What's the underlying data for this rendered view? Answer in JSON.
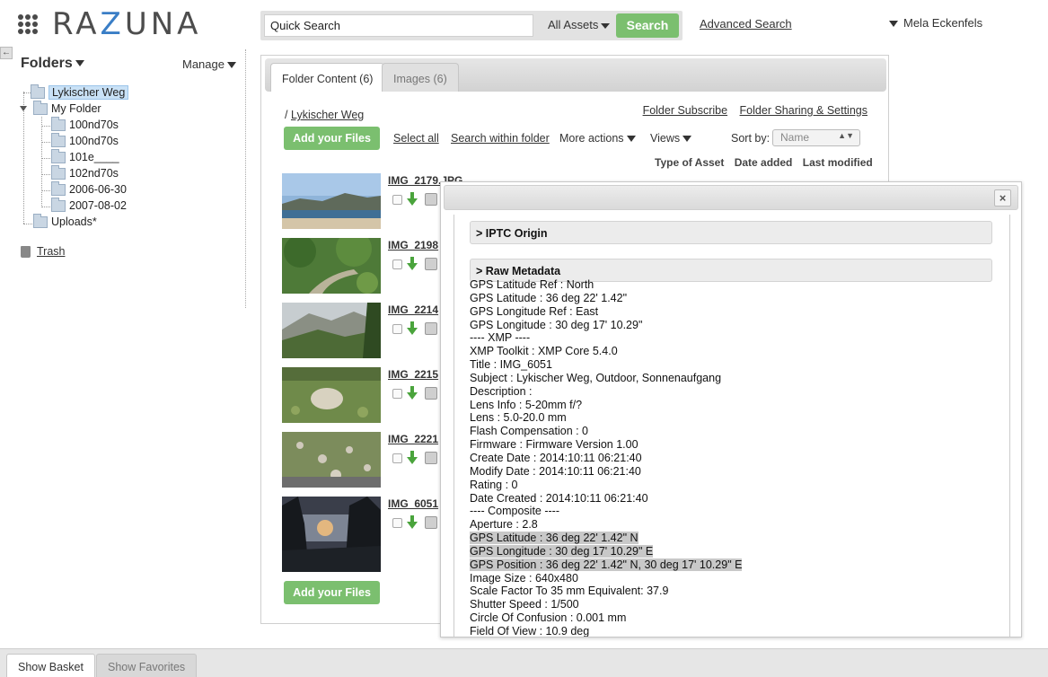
{
  "header": {
    "logo_text_1": "R",
    "logo_text_2": "A",
    "logo_text_z": "Z",
    "logo_text_3": "UNA",
    "search_value": "Quick Search",
    "asset_scope": "All Assets",
    "search_button": "Search",
    "advanced_search": "Advanced Search",
    "user_name": "Mela Eckenfels"
  },
  "sidebar": {
    "collapse_glyph": "←",
    "title": "Folders",
    "manage": "Manage",
    "tree": [
      {
        "label": "Lykischer Weg"
      },
      {
        "label": "My Folder"
      },
      {
        "label": "100nd70s"
      },
      {
        "label": "100nd70s"
      },
      {
        "label": "101e____"
      },
      {
        "label": "102nd70s"
      },
      {
        "label": "2006-06-30"
      },
      {
        "label": "2007-08-02"
      },
      {
        "label": "Uploads*"
      }
    ],
    "trash": "Trash"
  },
  "main": {
    "tabs": [
      {
        "label": "Folder Content (6)"
      },
      {
        "label": "Images (6)"
      }
    ],
    "breadcrumb_sep": "/",
    "breadcrumb": "Lykischer Weg",
    "folder_subscribe": "Folder Subscribe",
    "folder_sharing": "Folder Sharing & Settings",
    "add_files": "Add your Files",
    "select_all": "Select all",
    "search_within": "Search within folder",
    "more_actions": "More actions",
    "views": "Views",
    "sort_label": "Sort by:",
    "sort_value": "Name",
    "columns": [
      "Type of Asset",
      "Date added",
      "Last modified"
    ],
    "assets": [
      {
        "name": "IMG_2179.JPG"
      },
      {
        "name": "IMG_2198"
      },
      {
        "name": "IMG_2214"
      },
      {
        "name": "IMG_2215"
      },
      {
        "name": "IMG_2221"
      },
      {
        "name": "IMG_6051"
      }
    ]
  },
  "dialog": {
    "close": "×",
    "sections": [
      {
        "label": "> IPTC Origin"
      },
      {
        "label": "> Raw Metadata"
      }
    ],
    "lines": [
      {
        "text": "GPS Latitude Ref : North",
        "hl": false
      },
      {
        "text": "GPS Latitude : 36 deg 22' 1.42\"",
        "hl": false
      },
      {
        "text": "GPS Longitude Ref : East",
        "hl": false
      },
      {
        "text": "GPS Longitude : 30 deg 17' 10.29\"",
        "hl": false
      },
      {
        "text": "---- XMP ----",
        "hl": false
      },
      {
        "text": "XMP Toolkit : XMP Core 5.4.0",
        "hl": false
      },
      {
        "text": "Title : IMG_6051",
        "hl": false
      },
      {
        "text": "Subject : Lykischer Weg, Outdoor, Sonnenaufgang",
        "hl": false
      },
      {
        "text": "Description :",
        "hl": false
      },
      {
        "text": "Lens Info : 5-20mm f/?",
        "hl": false
      },
      {
        "text": "Lens : 5.0-20.0 mm",
        "hl": false
      },
      {
        "text": "Flash Compensation : 0",
        "hl": false
      },
      {
        "text": "Firmware : Firmware Version 1.00",
        "hl": false
      },
      {
        "text": "Create Date : 2014:10:11 06:21:40",
        "hl": false
      },
      {
        "text": "Modify Date : 2014:10:11 06:21:40",
        "hl": false
      },
      {
        "text": "Rating : 0",
        "hl": false
      },
      {
        "text": "Date Created : 2014:10:11 06:21:40",
        "hl": false
      },
      {
        "text": "---- Composite ----",
        "hl": false
      },
      {
        "text": "Aperture : 2.8",
        "hl": false
      },
      {
        "text": "GPS Latitude : 36 deg 22' 1.42\" N",
        "hl": true
      },
      {
        "text": "GPS Longitude : 30 deg 17' 10.29\" E",
        "hl": true
      },
      {
        "text": "GPS Position : 36 deg 22' 1.42\" N, 30 deg 17' 10.29\" E",
        "hl": true
      },
      {
        "text": "Image Size : 640x480",
        "hl": false
      },
      {
        "text": "Scale Factor To 35 mm Equivalent: 37.9",
        "hl": false
      },
      {
        "text": "Shutter Speed : 1/500",
        "hl": false
      },
      {
        "text": "Circle Of Confusion : 0.001 mm",
        "hl": false
      },
      {
        "text": "Field Of View : 10.9 deg",
        "hl": false
      }
    ]
  },
  "bottom": {
    "tabs": [
      {
        "label": "Show Basket"
      },
      {
        "label": "Show Favorites"
      }
    ]
  },
  "colors": {
    "accent_green": "#7bbf6f",
    "logo_blue": "#3a7ec6",
    "selection_blue": "#c9e1f6"
  }
}
